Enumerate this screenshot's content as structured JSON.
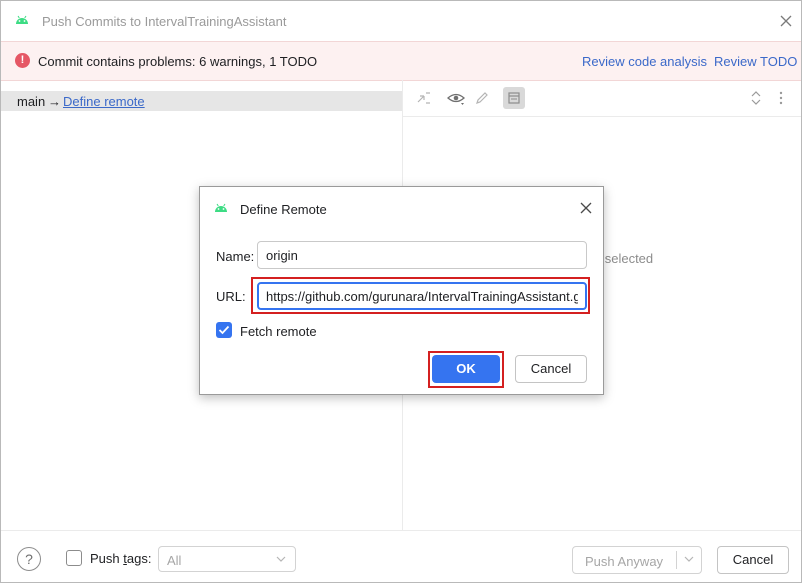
{
  "window": {
    "title": "Push Commits to IntervalTrainingAssistant",
    "app_icon": "android-icon",
    "close_icon": "close-icon"
  },
  "warning_bar": {
    "message": "Commit contains problems: 6 warnings, 1 TODO",
    "review_code_analysis": "Review code analysis",
    "review_todo": "Review TODO",
    "icon": "error-icon",
    "icon_color": "#e55765"
  },
  "left_pane": {
    "branch": "main",
    "arrow": "→",
    "define_remote_link": "Define remote"
  },
  "right_pane": {
    "toolbar_icons": [
      "collapse-icon",
      "eye-icon",
      "pencil-icon",
      "panel-icon",
      "expand-collapse-icon"
    ],
    "empty_text": "ts selected"
  },
  "footer": {
    "help": "?",
    "push_tags_label_prefix": "Push ",
    "push_tags_label_underlined": "t",
    "push_tags_label_suffix": "ags:",
    "tags_select_value": "All",
    "push_anyway": "Push Anyway",
    "cancel": "Cancel"
  },
  "dialog": {
    "title": "Define Remote",
    "name_label": "Name:",
    "name_value": "origin",
    "url_label": "URL:",
    "url_value": "https://github.com/gurunara/IntervalTrainingAssistant.git",
    "fetch_remote_label": "Fetch remote",
    "fetch_remote_checked": true,
    "ok": "OK",
    "cancel": "Cancel",
    "accent": "#3574f0",
    "highlight": "#d42020"
  }
}
